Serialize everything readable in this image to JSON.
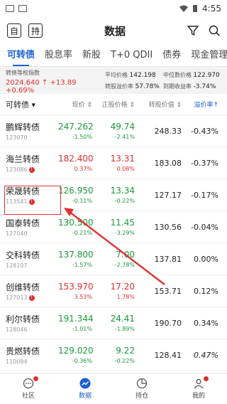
{
  "status": {
    "time": "4:55"
  },
  "header": {
    "left_btn1": "自",
    "left_btn2": "持",
    "title": "数据"
  },
  "tabs": [
    "可转债",
    "股息率",
    "新股",
    "T+0 QDII",
    "债券",
    "现金管理"
  ],
  "summary": {
    "index_label": "转债等权指数",
    "index_value": "2024.640 ↑ +13.89 +0.69%",
    "avg_price_label": "平均价格",
    "avg_price": "142.198",
    "median_price_label": "中位数价格",
    "median_price": "122.970",
    "up_ratio_label": "转股溢价率",
    "up_ratio": "57.78%",
    "ytm_label": "到期收益率",
    "ytm": "-3.74%"
  },
  "table": {
    "headers": {
      "name": "可转债",
      "price": "现价",
      "stock_price": "正股价格",
      "conv_value": "转股价值",
      "premium": "溢价率↑"
    },
    "rows": [
      {
        "name": "鹏辉转债",
        "code": "123070",
        "warn": false,
        "price": "247.262",
        "price_chg": "-1.50%",
        "price_color": "green",
        "sprice": "49.74",
        "sprice_chg": "-2.41%",
        "sprice_color": "green",
        "value": "248.33",
        "premium": "-0.43%",
        "premium_style": "dark"
      },
      {
        "name": "海兰转债",
        "code": "123086",
        "warn": true,
        "price": "182.400",
        "price_chg": "0.37%",
        "price_color": "red",
        "sprice": "13.31",
        "sprice_chg": "0.08%",
        "sprice_color": "red",
        "value": "183.08",
        "premium": "-0.37%",
        "premium_style": "dark"
      },
      {
        "name": "荣晟转债",
        "code": "113541",
        "warn": true,
        "price": "126.950",
        "price_chg": "-0.11%",
        "price_color": "green",
        "sprice": "13.34",
        "sprice_chg": "-0.22%",
        "sprice_color": "green",
        "value": "127.17",
        "premium": "-0.17%",
        "premium_style": "dark"
      },
      {
        "name": "国泰转债",
        "code": "127040",
        "warn": false,
        "price": "130.500",
        "price_chg": "-0.21%",
        "price_color": "green",
        "sprice": "11.45",
        "sprice_chg": "-3.29%",
        "sprice_color": "green",
        "value": "130.56",
        "premium": "-0.04%",
        "premium_style": "dark"
      },
      {
        "name": "交科转债",
        "code": "128107",
        "warn": false,
        "price": "137.800",
        "price_chg": "-1.57%",
        "price_color": "green",
        "sprice": "7.00",
        "sprice_chg": "-2.78%",
        "sprice_color": "green",
        "value": "137.81",
        "premium": "0.00%",
        "premium_style": "dark"
      },
      {
        "name": "创维转债",
        "code": "127013",
        "warn": true,
        "price": "153.970",
        "price_chg": "3.53%",
        "price_color": "red",
        "sprice": "17.20",
        "sprice_chg": "1.78%",
        "sprice_color": "red",
        "value": "153.71",
        "premium": "0.12%",
        "premium_style": "dark"
      },
      {
        "name": "利尔转债",
        "code": "128046",
        "warn": false,
        "price": "191.344",
        "price_chg": "-1.01%",
        "price_color": "green",
        "sprice": "24.41",
        "sprice_chg": "-1.89%",
        "sprice_color": "green",
        "value": "190.70",
        "premium": "0.34%",
        "premium_style": "dark"
      },
      {
        "name": "贵燃转债",
        "code": "110084",
        "warn": false,
        "price": "129.020",
        "price_chg": "-0.36%",
        "price_color": "green",
        "sprice": "9.22",
        "sprice_chg": "-0.22%",
        "sprice_color": "green",
        "value": "128.41",
        "premium": "0.47%",
        "premium_style": "italic"
      }
    ]
  },
  "bottom_nav": [
    {
      "label": "社区",
      "icon": "chat-icon",
      "active": false,
      "dot": true
    },
    {
      "label": "数据",
      "icon": "chart-icon",
      "active": true,
      "dot": false
    },
    {
      "label": "持仓",
      "icon": "pie-icon",
      "active": false,
      "dot": false
    },
    {
      "label": "我的",
      "icon": "user-icon",
      "active": false,
      "dot": true
    }
  ],
  "colors": {
    "accent": "#1a5fd6",
    "up": "#e03030",
    "down": "#1a9a3a"
  }
}
